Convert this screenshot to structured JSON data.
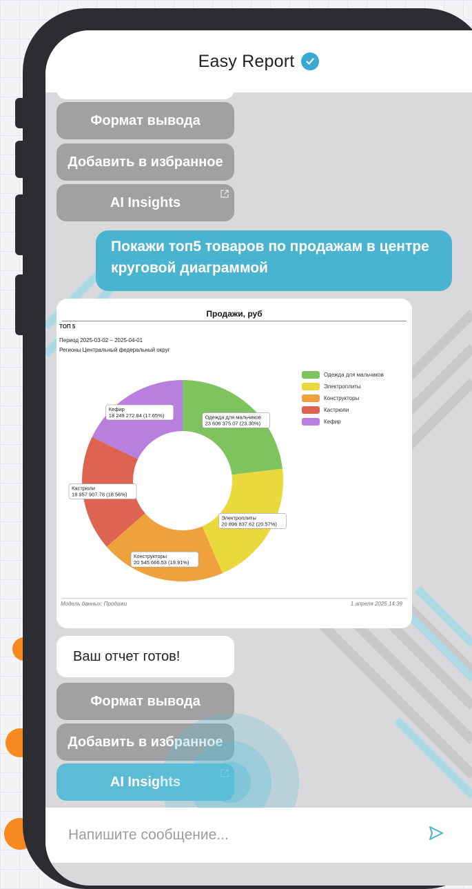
{
  "app": {
    "title": "Easy Report",
    "accent": "#4ab3cf",
    "verified_icon": "verified-check-icon"
  },
  "top_actions": [
    {
      "label": "Формат вывода"
    },
    {
      "label": "Добавить в избранное"
    },
    {
      "label": "AI Insights",
      "icon": "external-link-icon"
    }
  ],
  "user_message": {
    "line1": "Покажи топ5 товаров по продажам в центре",
    "line2": "круговой диаграммой"
  },
  "report": {
    "title": "Продажи, руб",
    "subtitle": "ТОП 5",
    "period": "Период   2025-03-02 – 2025-04-01",
    "regions": "Регионы  Центральный федеральный округ",
    "footer_left": "Модель данных: Продажи",
    "footer_right": "1 апреля 2025 14:39"
  },
  "chart_data": {
    "type": "pie",
    "title": "Продажи, руб",
    "donut": true,
    "categories": [
      "Одежда для мальчиков",
      "Электроплиты",
      "Конструкторы",
      "Кастрюли",
      "Кефир"
    ],
    "values": [
      23606375.07,
      20896837.62,
      20545666.53,
      18957907.78,
      18249272.84
    ],
    "percents": [
      23.3,
      20.57,
      19.91,
      18.56,
      17.65
    ],
    "labels": [
      [
        "Одежда для мальчиков",
        "23 606 375.07 (23.30%)"
      ],
      [
        "Электроплиты",
        "20 896 837.62 (20.57%)"
      ],
      [
        "Конструкторы",
        "20 545 666.53 (19.91%)"
      ],
      [
        "Кастрюли",
        "18 957 907.78 (18.56%)"
      ],
      [
        "Кефир",
        "18 249 272.84 (17.65%)"
      ]
    ],
    "colors": [
      "#7ec35d",
      "#e9d93d",
      "#efa13d",
      "#dc6450",
      "#b97fdf"
    ],
    "legend": "right"
  },
  "bot_message": "Ваш отчет готов!",
  "bottom_actions": [
    {
      "label": "Формат вывода"
    },
    {
      "label": "Добавить в избранное"
    },
    {
      "label": "AI Insights",
      "icon": "external-link-icon"
    }
  ],
  "composer": {
    "placeholder": "Напишите сообщение...",
    "send_icon": "send-icon"
  }
}
